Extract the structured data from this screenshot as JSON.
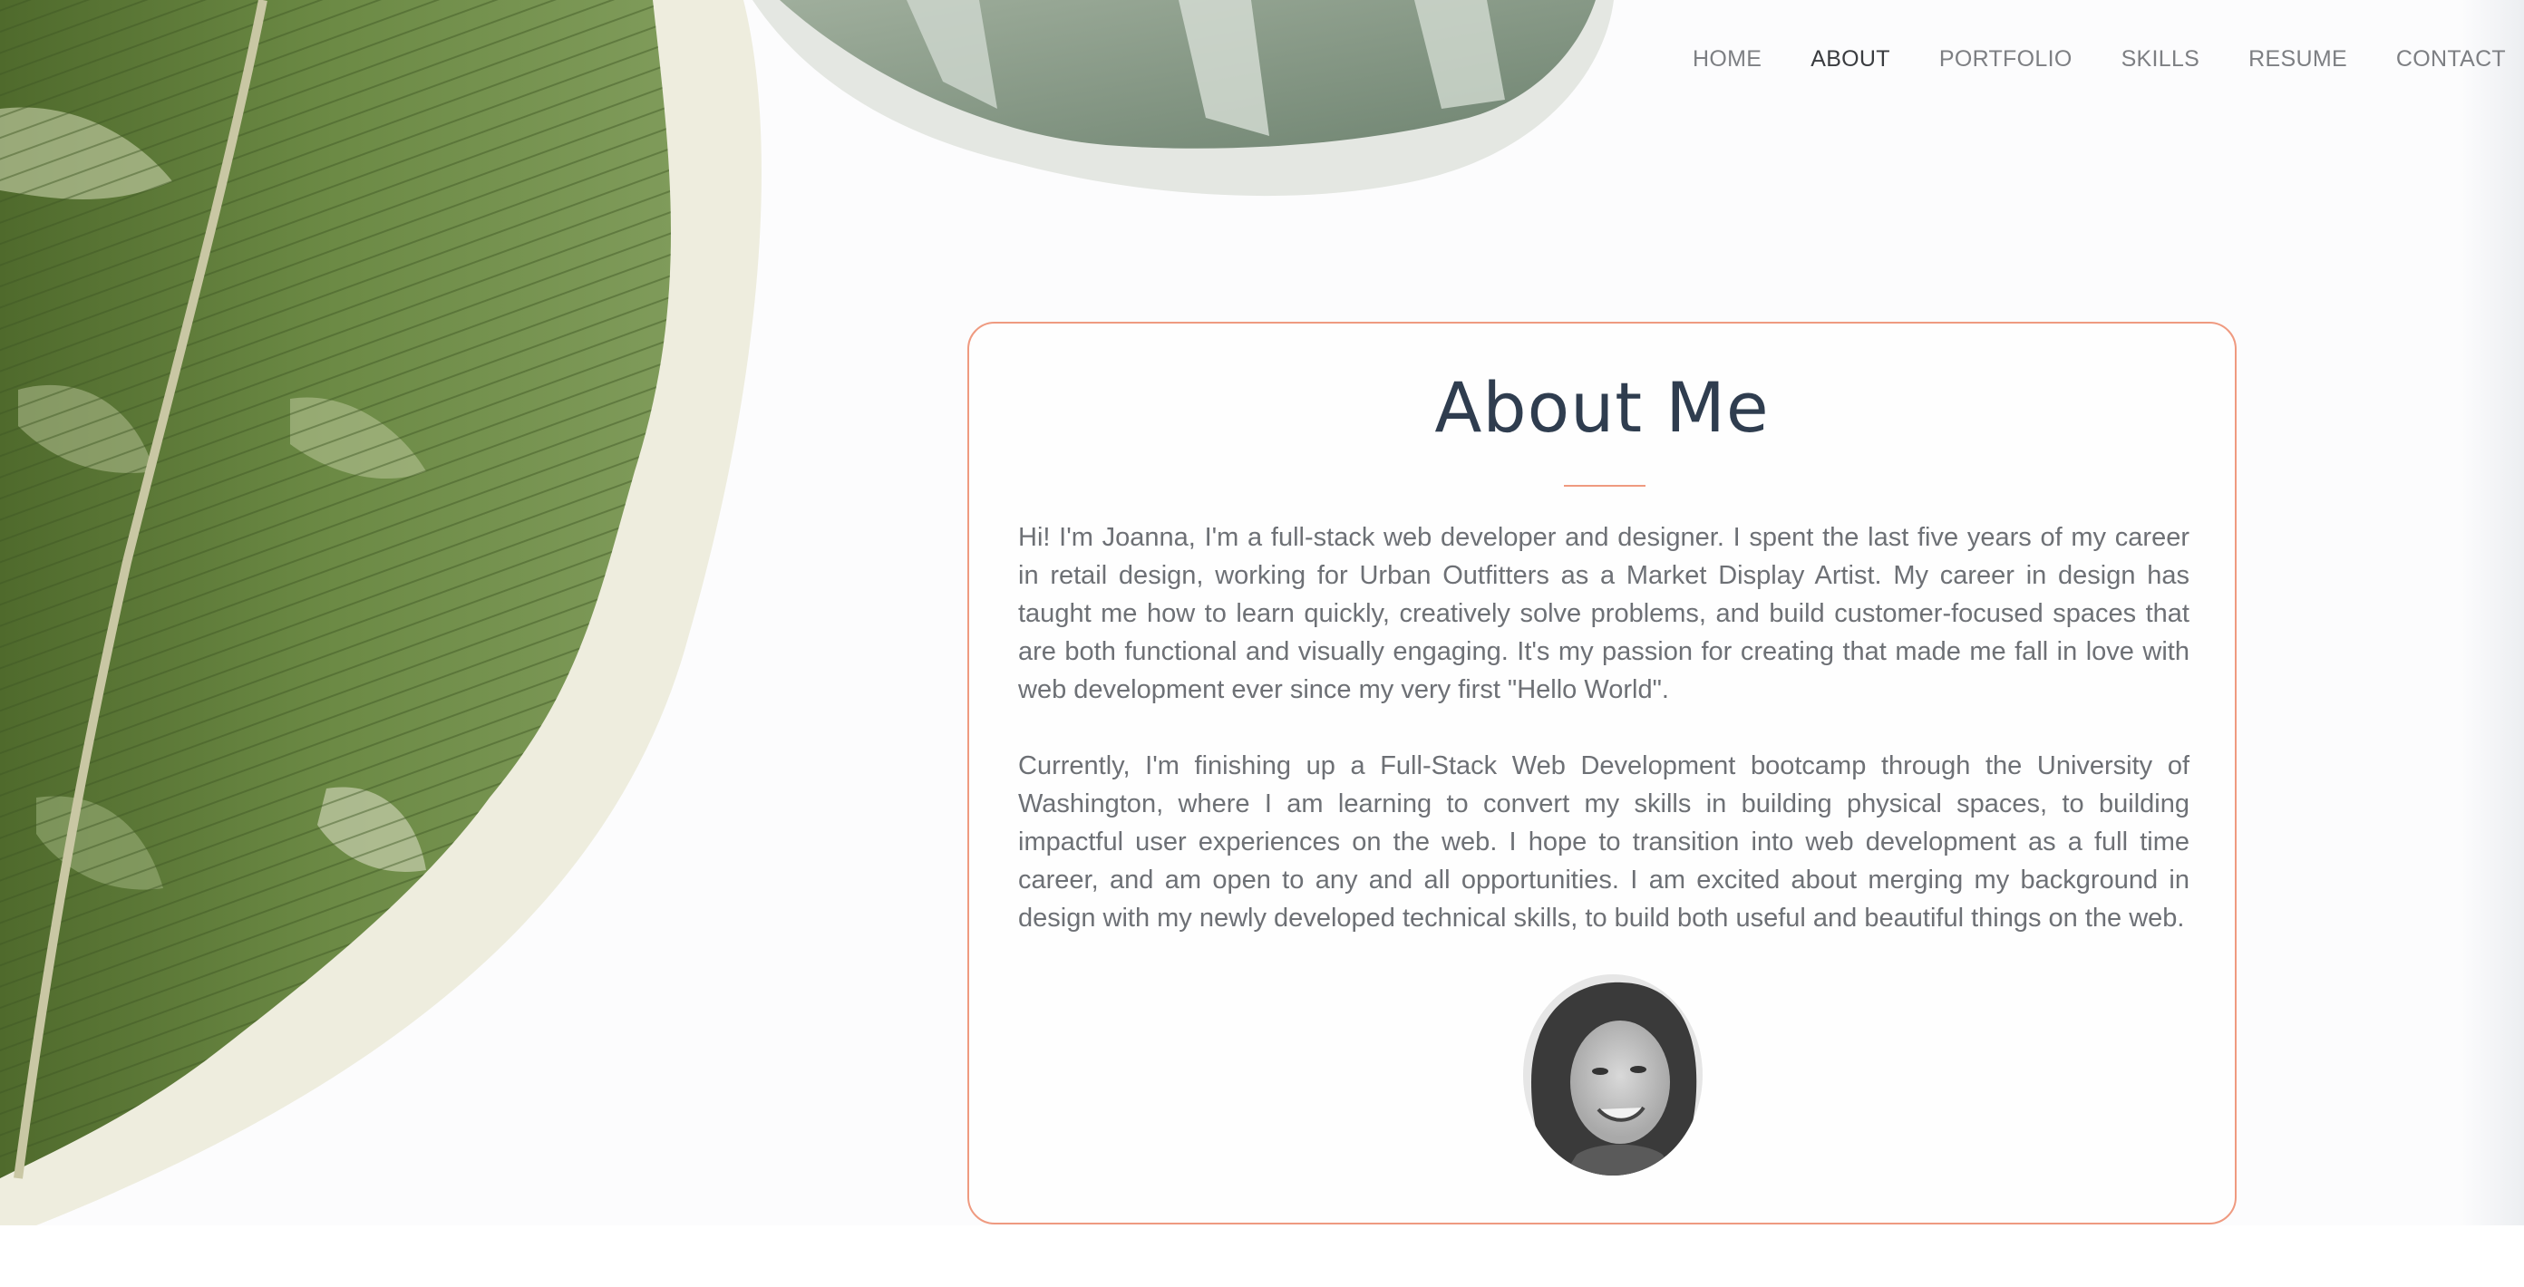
{
  "nav": {
    "items": [
      {
        "label": "HOME",
        "active": false
      },
      {
        "label": "ABOUT",
        "active": true
      },
      {
        "label": "PORTFOLIO",
        "active": false
      },
      {
        "label": "SKILLS",
        "active": false
      },
      {
        "label": "RESUME",
        "active": false
      },
      {
        "label": "CONTACT",
        "active": false
      }
    ]
  },
  "about": {
    "title": "About Me",
    "paragraphs": [
      "Hi! I'm Joanna, I'm a full-stack web developer and designer. I spent the last five years of my career in retail design, working for Urban Outfitters as a Market Display Artist. My career in design has taught me how to learn quickly, creatively solve problems, and build customer-focused spaces that are both functional and visually engaging. It's my passion for creating that made me fall in love with web development ever since my very first \"Hello World\".",
      "Currently, I'm finishing up a Full-Stack Web Development bootcamp through the University of Washington, where I am learning to convert my skills in building physical spaces, to building impactful user experiences on the web. I hope to transition into web development as a full time career, and am open to any and all opportunities. I am excited about merging my background in design with my newly developed technical skills, to build both useful and beautiful things on the web."
    ]
  },
  "colors": {
    "accent": "#ef9a80",
    "title": "#2f3d4f",
    "body_text": "#6d7075",
    "nav_text": "#7d7f83",
    "nav_active": "#3a3c40",
    "leaf_green": "#5e7a3a"
  },
  "icons": {
    "background": "variegated-leaf-image",
    "profile": "profile-photo"
  }
}
